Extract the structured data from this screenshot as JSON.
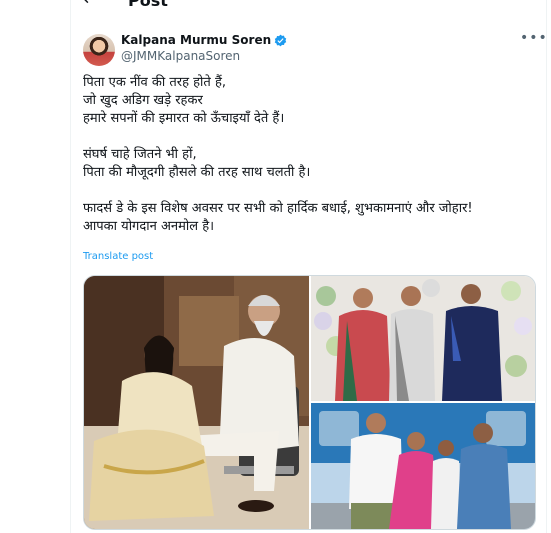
{
  "header": {
    "back_icon": "arrow-left-icon",
    "title": "Post"
  },
  "author": {
    "name": "Kalpana Murmu Soren",
    "handle": "@JMMKalpanaSoren",
    "verified_color": "#1d9bf0",
    "more_icon": "more-horizontal-icon"
  },
  "tweet": {
    "lines": [
      "पिता एक नींव की तरह होते हैं,",
      "जो खुद अडिग खड़े रहकर",
      "हमारे सपनों की इमारत को ऊँचाइयाँ देते हैं।",
      "",
      "संघर्ष चाहे जितने भी हों,",
      "पिता की मौजूदगी हौसले की तरह साथ चलती है।",
      "",
      "फादर्स डे के इस विशेष अवसर पर सभी को हार्दिक बधाई, शुभकामनाएं और जोहार!",
      "आपका योगदान अनमोल है।"
    ],
    "translate_label": "Translate post"
  },
  "colors": {
    "link": "#1d9bf0",
    "secondary_text": "#536471",
    "border": "#eff3f4"
  }
}
